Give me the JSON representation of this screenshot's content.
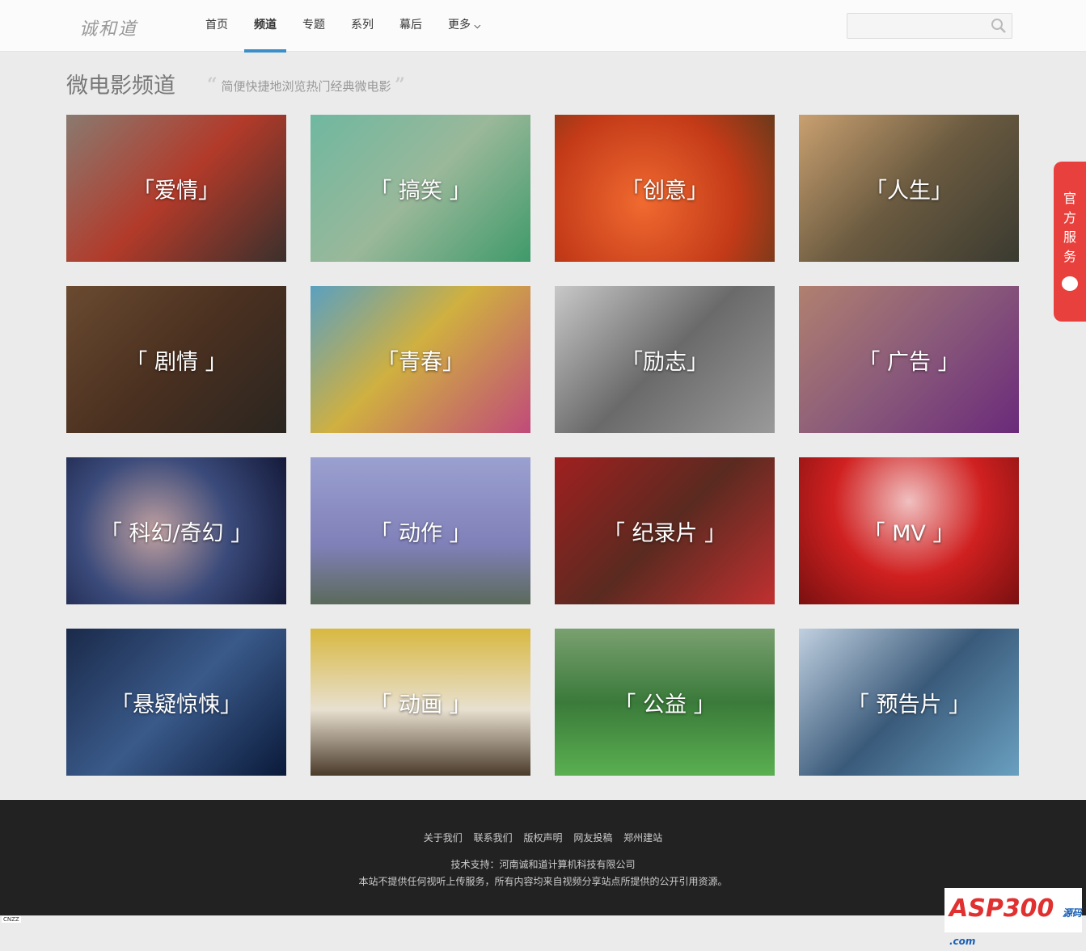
{
  "header": {
    "logo": "诚和道",
    "nav": [
      {
        "label": "首页"
      },
      {
        "label": "频道",
        "active": true
      },
      {
        "label": "专题"
      },
      {
        "label": "系列"
      },
      {
        "label": "幕后"
      },
      {
        "label": "更多"
      }
    ],
    "search_placeholder": ""
  },
  "page": {
    "title": "微电影频道",
    "subtitle": "简便快捷地浏览热门经典微电影",
    "open_quote": "“",
    "close_quote": "”"
  },
  "tiles": [
    {
      "label": "「爱情」",
      "bg": "linear-gradient(135deg,#8a7a70,#b23a2a 50%,#3a302c)"
    },
    {
      "label": "「 搞笑 」",
      "bg": "linear-gradient(135deg,#6fb8a0,#9ab89a 50%,#3f9a6a)"
    },
    {
      "label": "「创意」",
      "bg": "radial-gradient(circle at 40% 60%,#f06a30,#c33a18 60%,#6a3a1a)"
    },
    {
      "label": "「人生」",
      "bg": "linear-gradient(135deg,#c9a070,#6a5a40 50%,#3a3a30)"
    },
    {
      "label": "「 剧情 」",
      "bg": "linear-gradient(135deg,#6a4a30,#4a3020 50%,#2a2520)"
    },
    {
      "label": "「青春」",
      "bg": "linear-gradient(135deg,#5aa0c0,#d0b040 45%,#c04a7a)"
    },
    {
      "label": "「励志」",
      "bg": "linear-gradient(135deg,#c8c8c8,#6a6a6a 50%,#9a9a9a)"
    },
    {
      "label": "「 广告 」",
      "bg": "linear-gradient(135deg,#b08070,#8a5a7a 50%,#6a2a7a)"
    },
    {
      "label": "「 科幻/奇幻 」",
      "bg": "radial-gradient(circle at 40% 50%,#c0a0a0,#3a4a7a 50%,#141a3a)"
    },
    {
      "label": "「 动作 」",
      "bg": "linear-gradient(180deg,#9aa0d0,#8080b8 60%,#5a6a5a)"
    },
    {
      "label": "「 纪录片 」",
      "bg": "linear-gradient(135deg,#a02020,#5a2a20 50%,#c03030)"
    },
    {
      "label": "「 MV 」",
      "bg": "radial-gradient(circle at 50% 30%,#f0c0c0,#d02020 50%,#7a1010)"
    },
    {
      "label": "「悬疑惊悚」",
      "bg": "linear-gradient(135deg,#1a2a4a,#3a5a8a 50%,#0a1a3a)"
    },
    {
      "label": "「 动画 」",
      "bg": "linear-gradient(180deg,#d8b840,#e8e0d0 55%,#4a3a2a)"
    },
    {
      "label": "「 公益 」",
      "bg": "linear-gradient(180deg,#7aa070,#3a7a3a 50%,#5ab050)"
    },
    {
      "label": "「 预告片 」",
      "bg": "linear-gradient(135deg,#c0d0e0,#3a5a7a 50%,#6aa0c0)"
    }
  ],
  "side": {
    "label_chars": [
      "官",
      "方",
      "服",
      "务"
    ]
  },
  "footer": {
    "links": [
      "关于我们",
      "联系我们",
      "版权声明",
      "网友投稿",
      "郑州建站"
    ],
    "support": "技术支持：河南诚和道计算机科技有限公司",
    "disclaimer": "本站不提供任何视听上传服务，所有内容均来自视频分享站点所提供的公开引用资源。"
  },
  "badge": {
    "text": "ASP300",
    "sub": "源码 .com"
  },
  "cnzz": "CNZZ"
}
